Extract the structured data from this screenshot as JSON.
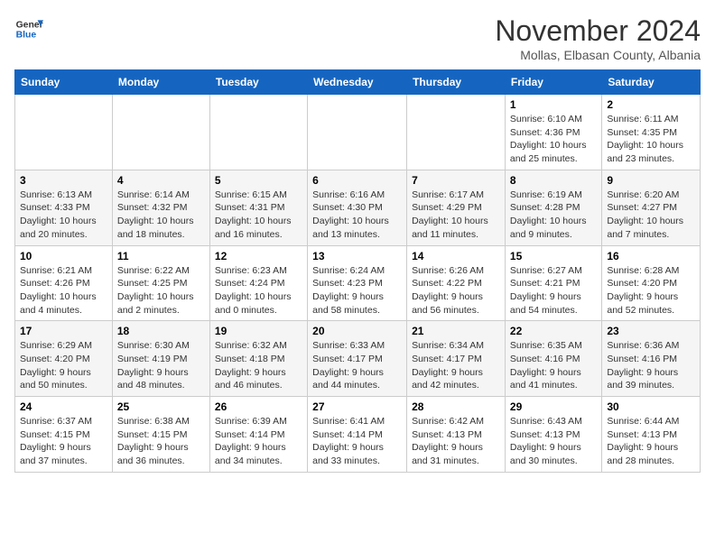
{
  "logo": {
    "line1": "General",
    "line2": "Blue"
  },
  "header": {
    "month": "November 2024",
    "location": "Mollas, Elbasan County, Albania"
  },
  "weekdays": [
    "Sunday",
    "Monday",
    "Tuesday",
    "Wednesday",
    "Thursday",
    "Friday",
    "Saturday"
  ],
  "rows": [
    [
      {
        "day": "",
        "info": ""
      },
      {
        "day": "",
        "info": ""
      },
      {
        "day": "",
        "info": ""
      },
      {
        "day": "",
        "info": ""
      },
      {
        "day": "",
        "info": ""
      },
      {
        "day": "1",
        "info": "Sunrise: 6:10 AM\nSunset: 4:36 PM\nDaylight: 10 hours and 25 minutes."
      },
      {
        "day": "2",
        "info": "Sunrise: 6:11 AM\nSunset: 4:35 PM\nDaylight: 10 hours and 23 minutes."
      }
    ],
    [
      {
        "day": "3",
        "info": "Sunrise: 6:13 AM\nSunset: 4:33 PM\nDaylight: 10 hours and 20 minutes."
      },
      {
        "day": "4",
        "info": "Sunrise: 6:14 AM\nSunset: 4:32 PM\nDaylight: 10 hours and 18 minutes."
      },
      {
        "day": "5",
        "info": "Sunrise: 6:15 AM\nSunset: 4:31 PM\nDaylight: 10 hours and 16 minutes."
      },
      {
        "day": "6",
        "info": "Sunrise: 6:16 AM\nSunset: 4:30 PM\nDaylight: 10 hours and 13 minutes."
      },
      {
        "day": "7",
        "info": "Sunrise: 6:17 AM\nSunset: 4:29 PM\nDaylight: 10 hours and 11 minutes."
      },
      {
        "day": "8",
        "info": "Sunrise: 6:19 AM\nSunset: 4:28 PM\nDaylight: 10 hours and 9 minutes."
      },
      {
        "day": "9",
        "info": "Sunrise: 6:20 AM\nSunset: 4:27 PM\nDaylight: 10 hours and 7 minutes."
      }
    ],
    [
      {
        "day": "10",
        "info": "Sunrise: 6:21 AM\nSunset: 4:26 PM\nDaylight: 10 hours and 4 minutes."
      },
      {
        "day": "11",
        "info": "Sunrise: 6:22 AM\nSunset: 4:25 PM\nDaylight: 10 hours and 2 minutes."
      },
      {
        "day": "12",
        "info": "Sunrise: 6:23 AM\nSunset: 4:24 PM\nDaylight: 10 hours and 0 minutes."
      },
      {
        "day": "13",
        "info": "Sunrise: 6:24 AM\nSunset: 4:23 PM\nDaylight: 9 hours and 58 minutes."
      },
      {
        "day": "14",
        "info": "Sunrise: 6:26 AM\nSunset: 4:22 PM\nDaylight: 9 hours and 56 minutes."
      },
      {
        "day": "15",
        "info": "Sunrise: 6:27 AM\nSunset: 4:21 PM\nDaylight: 9 hours and 54 minutes."
      },
      {
        "day": "16",
        "info": "Sunrise: 6:28 AM\nSunset: 4:20 PM\nDaylight: 9 hours and 52 minutes."
      }
    ],
    [
      {
        "day": "17",
        "info": "Sunrise: 6:29 AM\nSunset: 4:20 PM\nDaylight: 9 hours and 50 minutes."
      },
      {
        "day": "18",
        "info": "Sunrise: 6:30 AM\nSunset: 4:19 PM\nDaylight: 9 hours and 48 minutes."
      },
      {
        "day": "19",
        "info": "Sunrise: 6:32 AM\nSunset: 4:18 PM\nDaylight: 9 hours and 46 minutes."
      },
      {
        "day": "20",
        "info": "Sunrise: 6:33 AM\nSunset: 4:17 PM\nDaylight: 9 hours and 44 minutes."
      },
      {
        "day": "21",
        "info": "Sunrise: 6:34 AM\nSunset: 4:17 PM\nDaylight: 9 hours and 42 minutes."
      },
      {
        "day": "22",
        "info": "Sunrise: 6:35 AM\nSunset: 4:16 PM\nDaylight: 9 hours and 41 minutes."
      },
      {
        "day": "23",
        "info": "Sunrise: 6:36 AM\nSunset: 4:16 PM\nDaylight: 9 hours and 39 minutes."
      }
    ],
    [
      {
        "day": "24",
        "info": "Sunrise: 6:37 AM\nSunset: 4:15 PM\nDaylight: 9 hours and 37 minutes."
      },
      {
        "day": "25",
        "info": "Sunrise: 6:38 AM\nSunset: 4:15 PM\nDaylight: 9 hours and 36 minutes."
      },
      {
        "day": "26",
        "info": "Sunrise: 6:39 AM\nSunset: 4:14 PM\nDaylight: 9 hours and 34 minutes."
      },
      {
        "day": "27",
        "info": "Sunrise: 6:41 AM\nSunset: 4:14 PM\nDaylight: 9 hours and 33 minutes."
      },
      {
        "day": "28",
        "info": "Sunrise: 6:42 AM\nSunset: 4:13 PM\nDaylight: 9 hours and 31 minutes."
      },
      {
        "day": "29",
        "info": "Sunrise: 6:43 AM\nSunset: 4:13 PM\nDaylight: 9 hours and 30 minutes."
      },
      {
        "day": "30",
        "info": "Sunrise: 6:44 AM\nSunset: 4:13 PM\nDaylight: 9 hours and 28 minutes."
      }
    ]
  ]
}
